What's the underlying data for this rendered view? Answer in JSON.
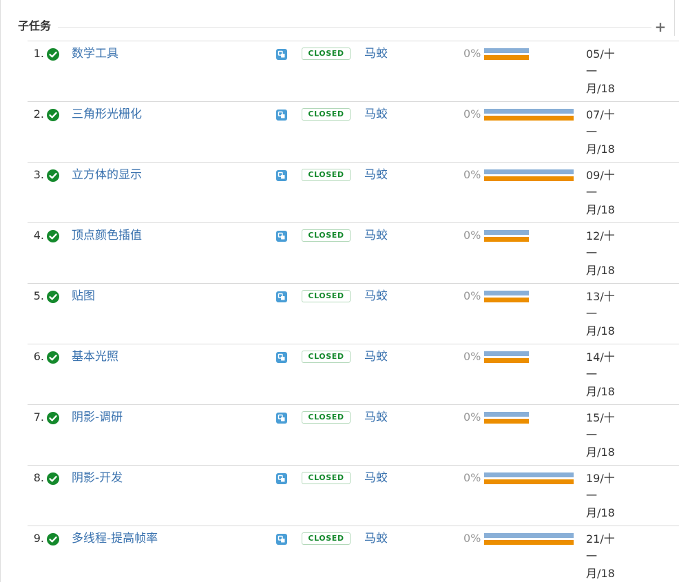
{
  "section": {
    "title": "子任务",
    "add_label": "+"
  },
  "colors": {
    "link": "#3b73af",
    "status_text": "#14892c",
    "status_border": "#b2d8b9",
    "done_icon": "#14892c",
    "estimate_bar": "#89afd7",
    "remaining_bar": "#ec8e00",
    "type_icon": "#4a9ed6"
  },
  "subtasks": [
    {
      "number": "1.",
      "done_icon": "check-circle-icon",
      "name": "数学工具",
      "type_icon": "subtask-type-icon",
      "status": "CLOSED",
      "assignee": "马蛟",
      "progress": "0%",
      "estimate_fraction": 0.5,
      "due": [
        "05/十",
        "一",
        "月/18"
      ]
    },
    {
      "number": "2.",
      "done_icon": "check-circle-icon",
      "name": "三角形光栅化",
      "type_icon": "subtask-type-icon",
      "status": "CLOSED",
      "assignee": "马蛟",
      "progress": "0%",
      "estimate_fraction": 1.0,
      "due": [
        "07/十",
        "一",
        "月/18"
      ]
    },
    {
      "number": "3.",
      "done_icon": "check-circle-icon",
      "name": "立方体的显示",
      "type_icon": "subtask-type-icon",
      "status": "CLOSED",
      "assignee": "马蛟",
      "progress": "0%",
      "estimate_fraction": 1.0,
      "due": [
        "09/十",
        "一",
        "月/18"
      ]
    },
    {
      "number": "4.",
      "done_icon": "check-circle-icon",
      "name": "顶点颜色插值",
      "type_icon": "subtask-type-icon",
      "status": "CLOSED",
      "assignee": "马蛟",
      "progress": "0%",
      "estimate_fraction": 0.5,
      "due": [
        "12/十",
        "一",
        "月/18"
      ]
    },
    {
      "number": "5.",
      "done_icon": "check-circle-icon",
      "name": "贴图",
      "type_icon": "subtask-type-icon",
      "status": "CLOSED",
      "assignee": "马蛟",
      "progress": "0%",
      "estimate_fraction": 0.5,
      "due": [
        "13/十",
        "一",
        "月/18"
      ]
    },
    {
      "number": "6.",
      "done_icon": "check-circle-icon",
      "name": "基本光照",
      "type_icon": "subtask-type-icon",
      "status": "CLOSED",
      "assignee": "马蛟",
      "progress": "0%",
      "estimate_fraction": 0.5,
      "due": [
        "14/十",
        "一",
        "月/18"
      ]
    },
    {
      "number": "7.",
      "done_icon": "check-circle-icon",
      "name": "阴影-调研",
      "type_icon": "subtask-type-icon",
      "status": "CLOSED",
      "assignee": "马蛟",
      "progress": "0%",
      "estimate_fraction": 0.5,
      "due": [
        "15/十",
        "一",
        "月/18"
      ]
    },
    {
      "number": "8.",
      "done_icon": "check-circle-icon",
      "name": "阴影-开发",
      "type_icon": "subtask-type-icon",
      "status": "CLOSED",
      "assignee": "马蛟",
      "progress": "0%",
      "estimate_fraction": 1.0,
      "due": [
        "19/十",
        "一",
        "月/18"
      ]
    },
    {
      "number": "9.",
      "done_icon": "check-circle-icon",
      "name": "多线程-提高帧率",
      "type_icon": "subtask-type-icon",
      "status": "CLOSED",
      "assignee": "马蛟",
      "progress": "0%",
      "estimate_fraction": 1.0,
      "due": [
        "21/十",
        "一",
        "月/18"
      ]
    }
  ]
}
